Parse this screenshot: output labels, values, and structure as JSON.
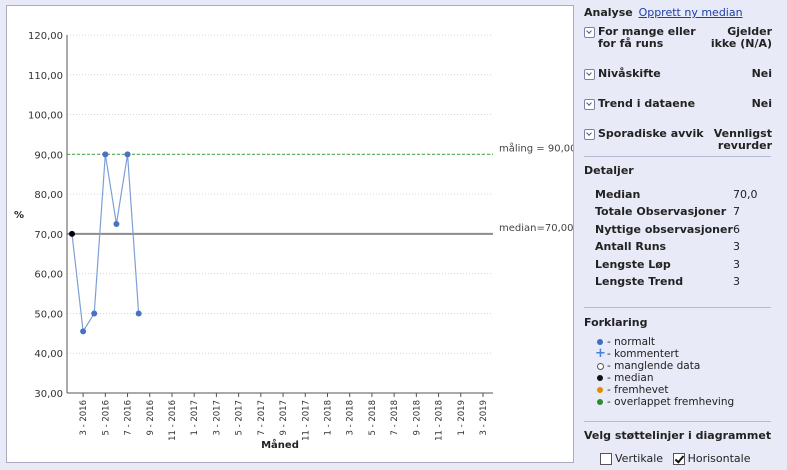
{
  "chart_data": {
    "type": "line",
    "ylabel": "%",
    "xlabel": "Måned",
    "ylim": [
      30,
      120
    ],
    "yticks": [
      "120,00",
      "110,00",
      "100,00",
      "90,00",
      "80,00",
      "70,00",
      "60,00",
      "50,00",
      "40,00",
      "30,00"
    ],
    "ytick_values": [
      120,
      110,
      100,
      90,
      80,
      70,
      60,
      50,
      40,
      30
    ],
    "categories": [
      "3 - 2016",
      "5 - 2016",
      "7 - 2016",
      "9 - 2016",
      "11 - 2016",
      "1 - 2017",
      "3 - 2017",
      "5 - 2017",
      "7 - 2017",
      "9 - 2017",
      "11 - 2017",
      "1 - 2018",
      "3 - 2018",
      "5 - 2018",
      "7 - 2018",
      "9 - 2018",
      "11 - 2018",
      "1 - 2019",
      "3 - 2019"
    ],
    "series": [
      {
        "x": [
          "2 - 2016",
          "3 - 2016",
          "4 - 2016",
          "5 - 2016",
          "6 - 2016",
          "7 - 2016",
          "8 - 2016"
        ],
        "values": [
          70,
          45.5,
          50,
          90,
          72.5,
          90,
          50
        ],
        "point_types": [
          "median",
          "normalt",
          "normalt",
          "normalt",
          "normalt",
          "normalt",
          "normalt"
        ]
      }
    ],
    "reference_lines": [
      {
        "label": "måling = 90,00",
        "value": 90,
        "color": "#4caf50",
        "style": "dashed"
      },
      {
        "label": "median=70,00",
        "value": 70,
        "color": "#8c8c8c",
        "style": "solid"
      }
    ],
    "grid": "horizontal",
    "colors": {
      "series": "#7f9fd4",
      "point": "#4a72c2",
      "median_point": "#000000"
    }
  },
  "side": {
    "analyse_label": "Analyse",
    "analyse_link": "Opprett ny median",
    "criteria": [
      {
        "label": "For mange eller for få runs",
        "value": "Gjelder ikke (N/A)"
      },
      {
        "label": "Nivåskifte",
        "value": "Nei"
      },
      {
        "label": "Trend i dataene",
        "value": "Nei"
      },
      {
        "label": "Sporadiske avvik",
        "value": "Vennligst revurder"
      }
    ],
    "details_title": "Detaljer",
    "details": [
      {
        "label": "Median",
        "value": "70,0"
      },
      {
        "label": "Totale Observasjoner",
        "value": "7"
      },
      {
        "label": "Nyttige observasjoner",
        "value": "6"
      },
      {
        "label": "Antall Runs",
        "value": "3"
      },
      {
        "label": "Lengste Løp",
        "value": "3"
      },
      {
        "label": "Lengste Trend",
        "value": "3"
      }
    ],
    "legend_title": "Forklaring",
    "legend": [
      {
        "label": "- normalt",
        "marker": "filled-dot",
        "color": "#3f6fc4"
      },
      {
        "label": "- kommentert",
        "marker": "plus",
        "color": "#4a7fd6"
      },
      {
        "label": "- manglende data",
        "marker": "hollow-dot",
        "color": "#555555"
      },
      {
        "label": "- median",
        "marker": "filled-dot",
        "color": "#111111"
      },
      {
        "label": "- fremhevet",
        "marker": "filled-dot",
        "color": "#e68a00"
      },
      {
        "label": "- overlappet fremheving",
        "marker": "filled-dot",
        "color": "#2e8b2e"
      }
    ],
    "support_title": "Velg støttelinjer i diagrammet",
    "vertical_label": "Vertikale",
    "vertical_checked": false,
    "horizontal_label": "Horisontale",
    "horizontal_checked": true
  }
}
